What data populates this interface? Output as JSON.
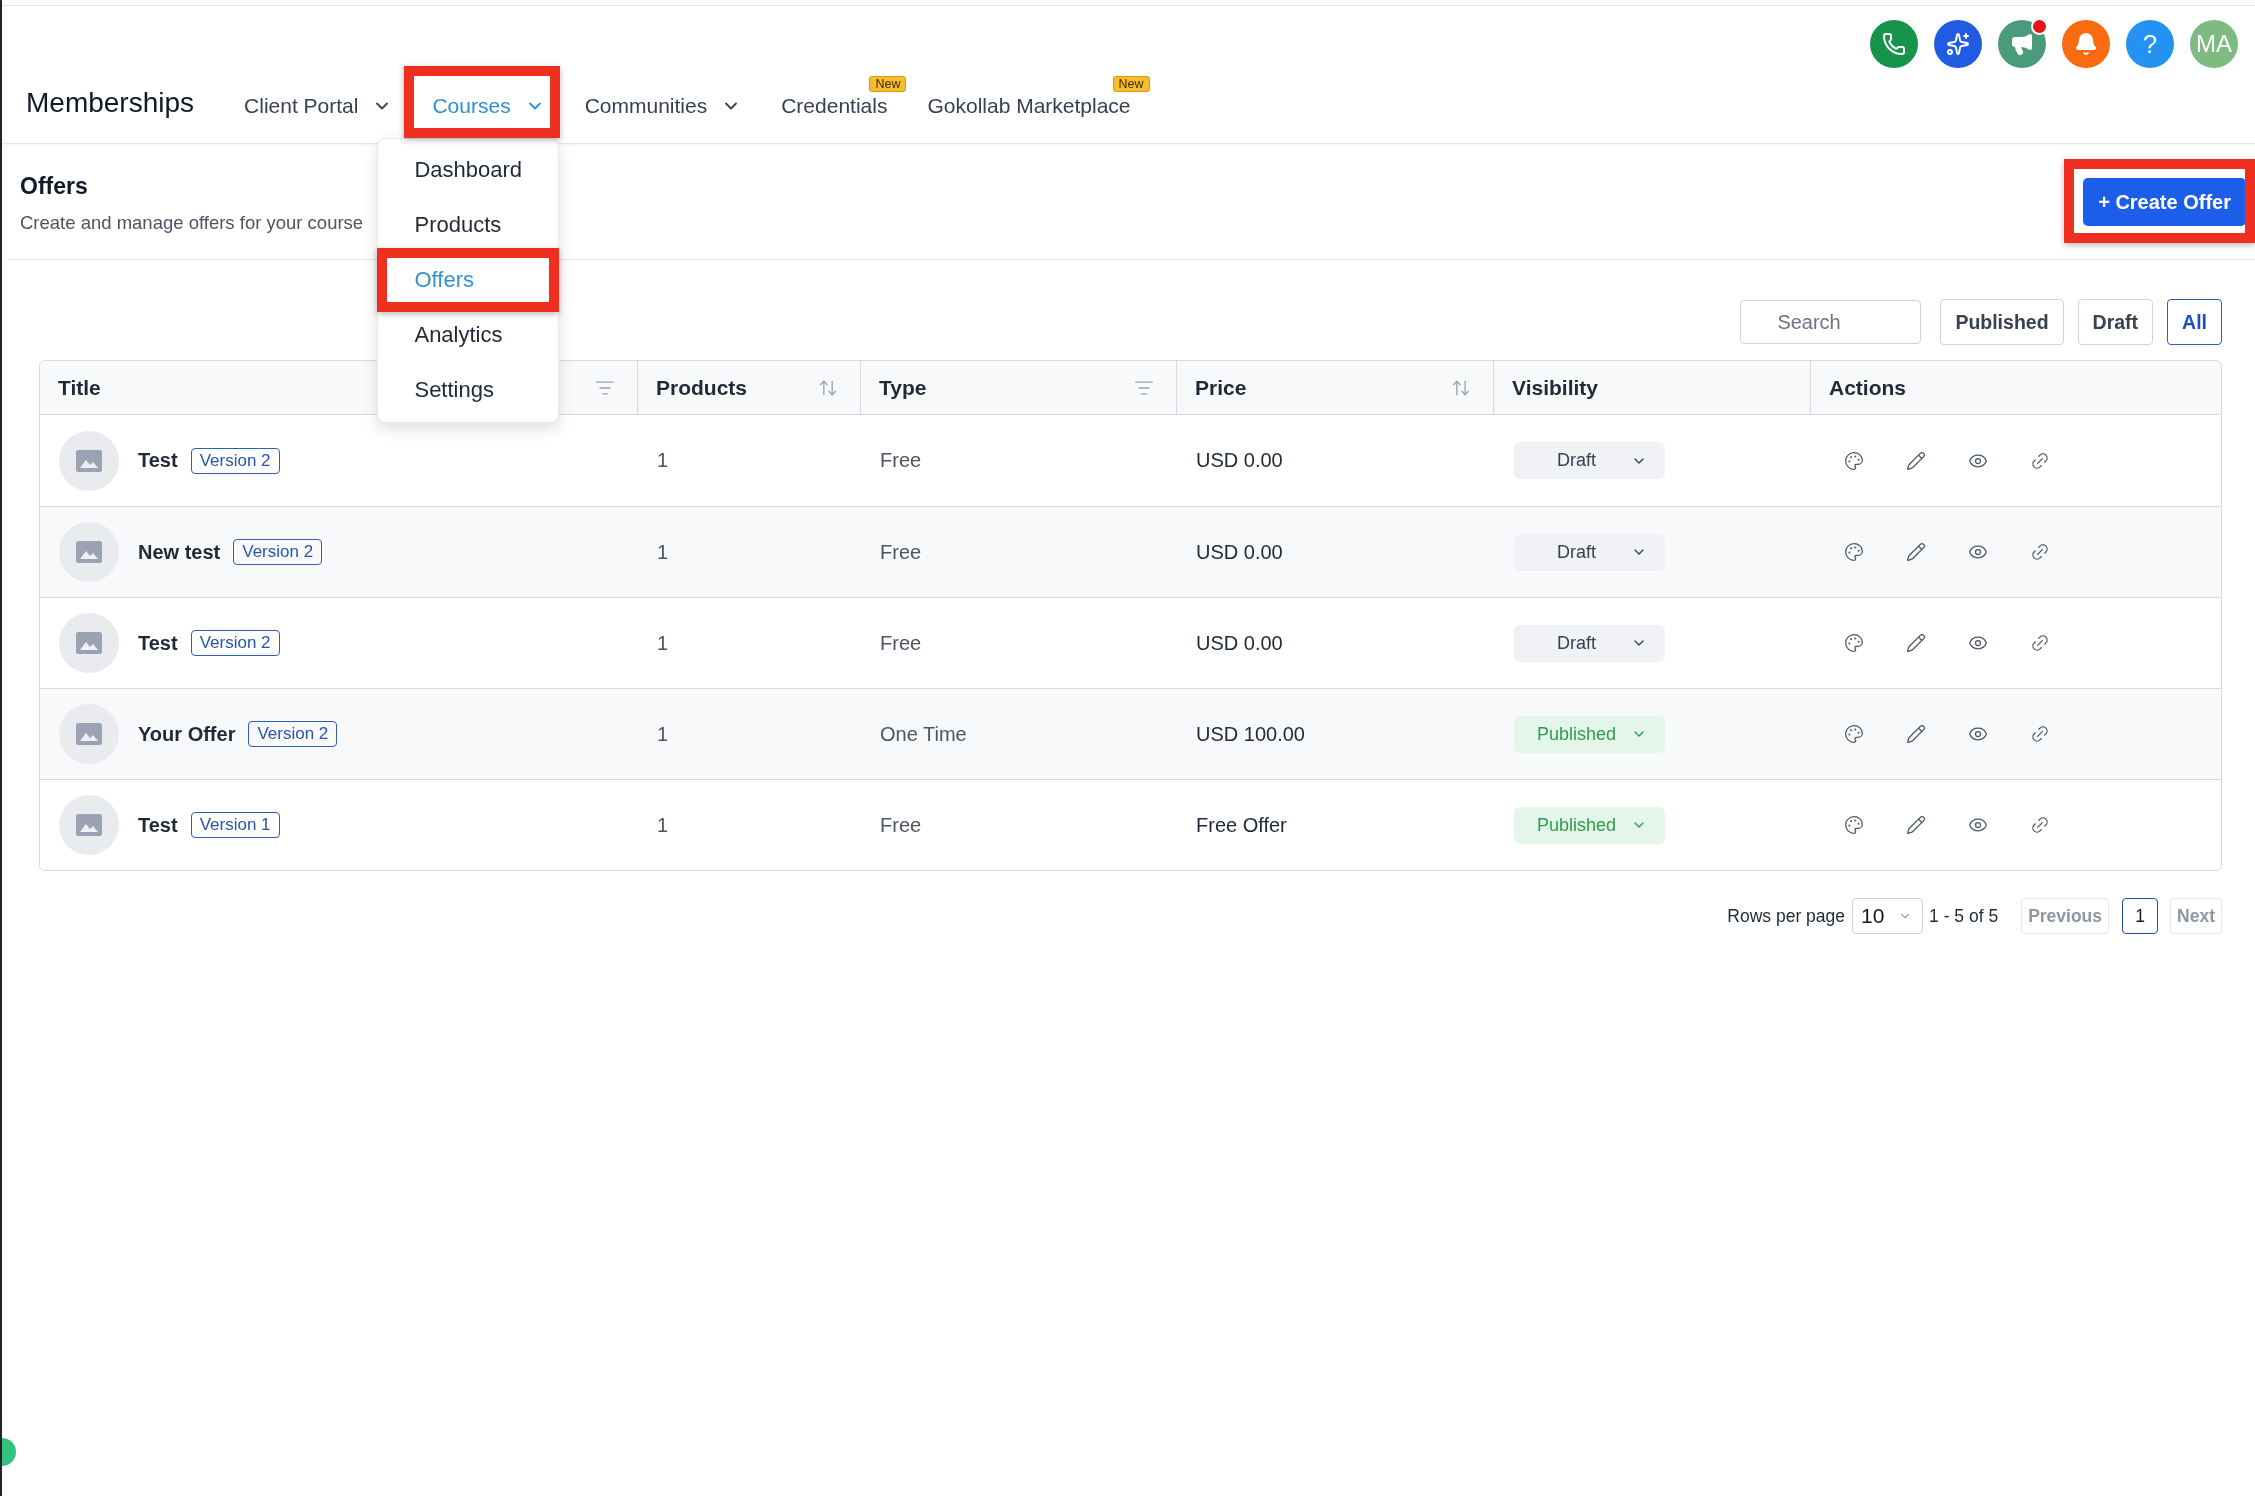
{
  "toolbar": [
    {
      "kind": "phone",
      "notification": false
    },
    {
      "kind": "sparkles",
      "notification": false
    },
    {
      "kind": "megaphone",
      "notification": true
    },
    {
      "kind": "bell",
      "notification": false
    },
    {
      "kind": "help",
      "label": "?",
      "notification": false
    },
    {
      "kind": "avatar",
      "label": "MA",
      "notification": false
    }
  ],
  "nav": {
    "brand": "Memberships",
    "items": [
      {
        "label": "Client Portal",
        "selected": false,
        "dropdown": true,
        "expanded": false,
        "highlighted": false
      },
      {
        "label": "Courses",
        "selected": true,
        "dropdown": true,
        "expanded": true,
        "highlighted": true,
        "menu": [
          {
            "label": "Dashboard",
            "selected": false,
            "highlighted": false
          },
          {
            "label": "Products",
            "selected": false,
            "highlighted": false
          },
          {
            "label": "Offers",
            "selected": true,
            "highlighted": true
          },
          {
            "label": "Analytics",
            "selected": false,
            "highlighted": false
          },
          {
            "label": "Settings",
            "selected": false,
            "highlighted": false
          }
        ]
      },
      {
        "label": "Communities",
        "selected": false,
        "dropdown": true,
        "expanded": false,
        "highlighted": false
      },
      {
        "label": "Credentials",
        "selected": false,
        "dropdown": false,
        "highlighted": false,
        "badge": "New"
      },
      {
        "label": "Gokollab Marketplace",
        "selected": false,
        "dropdown": false,
        "highlighted": false,
        "badge": "New"
      }
    ]
  },
  "page_header": {
    "title": "Offers",
    "subtitle": "Create and manage offers for your course",
    "create_button": {
      "label": "+ Create Offer",
      "highlighted": true
    }
  },
  "filters": {
    "search": {
      "placeholder": "Search"
    },
    "tabs": [
      {
        "label": "Published",
        "selected": false
      },
      {
        "label": "Draft",
        "selected": false
      },
      {
        "label": "All",
        "selected": true
      }
    ]
  },
  "table": {
    "columns": [
      {
        "label": "Title",
        "kind": "filter"
      },
      {
        "label": "Products",
        "kind": "sort"
      },
      {
        "label": "Type",
        "kind": "filter"
      },
      {
        "label": "Price",
        "kind": "sort"
      },
      {
        "label": "Visibility",
        "kind": "plain"
      },
      {
        "label": "Actions",
        "kind": "plain"
      }
    ],
    "rows": [
      {
        "title": "Test",
        "version": "Version 2",
        "products": "1",
        "type": "Free",
        "price": "USD 0.00",
        "visibility": {
          "label": "Draft",
          "kind": "draft"
        }
      },
      {
        "title": "New test",
        "version": "Version 2",
        "products": "1",
        "type": "Free",
        "price": "USD 0.00",
        "visibility": {
          "label": "Draft",
          "kind": "draft"
        }
      },
      {
        "title": "Test",
        "version": "Version 2",
        "products": "1",
        "type": "Free",
        "price": "USD 0.00",
        "visibility": {
          "label": "Draft",
          "kind": "draft"
        }
      },
      {
        "title": "Your Offer",
        "version": "Version 2",
        "products": "1",
        "type": "One Time",
        "price": "USD 100.00",
        "visibility": {
          "label": "Published",
          "kind": "published"
        }
      },
      {
        "title": "Test",
        "version": "Version 1",
        "products": "1",
        "type": "Free",
        "price": "Free Offer",
        "visibility": {
          "label": "Published",
          "kind": "published"
        }
      }
    ]
  },
  "pagination": {
    "label": "Rows per page",
    "rows_per_page": "10",
    "range": "1 - 5 of 5",
    "previous": {
      "label": "Previous",
      "disabled": true
    },
    "pages": [
      {
        "label": "1",
        "selected": true
      }
    ],
    "next": {
      "label": "Next",
      "disabled": true
    }
  }
}
